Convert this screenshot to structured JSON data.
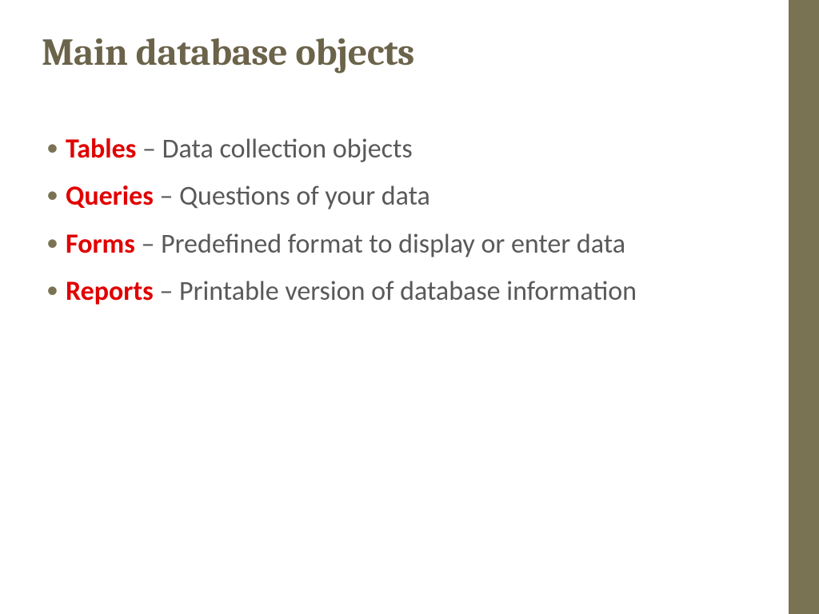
{
  "title": "Main database objects",
  "items": [
    {
      "term": "Tables",
      "desc": " – Data collection objects"
    },
    {
      "term": "Queries",
      "desc": " – Questions of your data"
    },
    {
      "term": "Forms",
      "desc": " – Predefined format to display or enter data"
    },
    {
      "term": "Reports",
      "desc": " – Printable version of database information"
    }
  ]
}
